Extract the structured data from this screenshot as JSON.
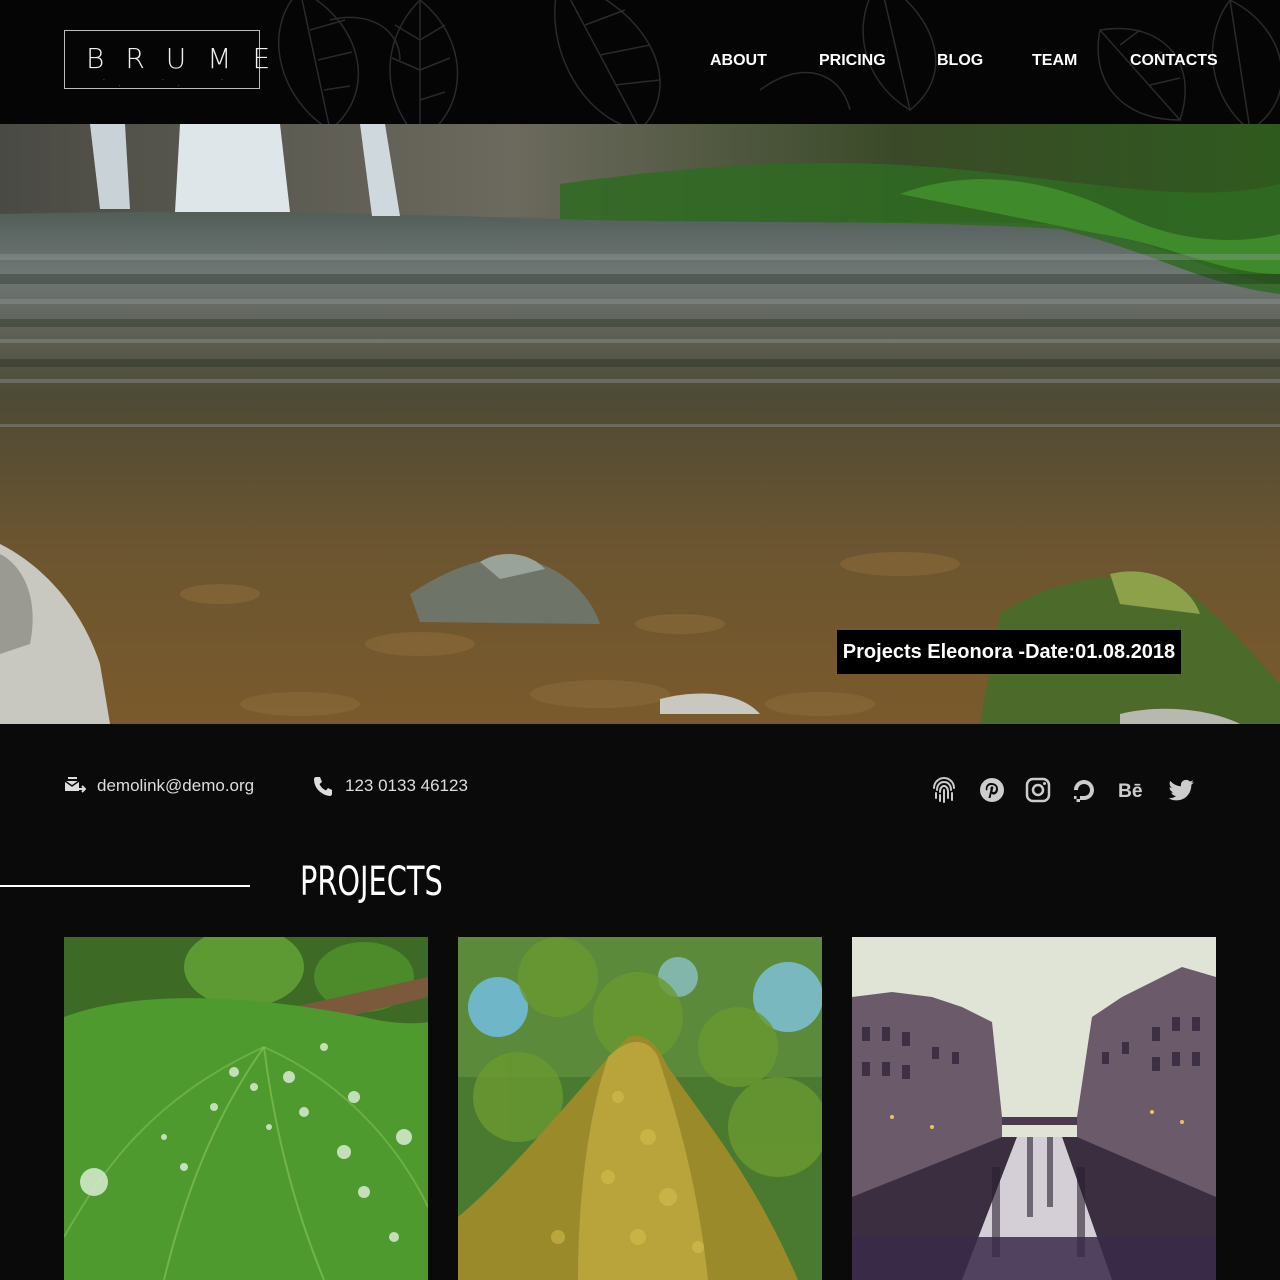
{
  "brand": {
    "name": "BRUME",
    "tagline_dots": "· · · · ·"
  },
  "nav": {
    "items": [
      {
        "label": "ABOUT"
      },
      {
        "label": "PRICING"
      },
      {
        "label": "BLOG"
      },
      {
        "label": "TEAM"
      },
      {
        "label": "CONTACTS"
      }
    ]
  },
  "hero": {
    "image": "river-waterfall-photo",
    "caption": "Projects Eleonora -Date:01.08.2018"
  },
  "contact": {
    "email": "demolink@demo.org",
    "email_icon": "envelope-transfer-icon",
    "phone": "123 0133 46123",
    "phone_icon": "phone-icon"
  },
  "socials": [
    {
      "name": "fingerprint-icon"
    },
    {
      "name": "pinterest-icon"
    },
    {
      "name": "instagram-icon"
    },
    {
      "name": "digitalocean-icon"
    },
    {
      "name": "behance-icon"
    },
    {
      "name": "twitter-icon"
    }
  ],
  "projects": {
    "title": "PROJECTS",
    "cards": [
      {
        "image": "ginkgo-leaf-raindrops-photo"
      },
      {
        "image": "mossy-tree-trunk-photo"
      },
      {
        "image": "canal-city-evening-photo"
      }
    ]
  },
  "colors": {
    "background": "#0a0a0a",
    "header": "#050505",
    "text": "#ffffff",
    "muted_text": "#dddddd"
  }
}
